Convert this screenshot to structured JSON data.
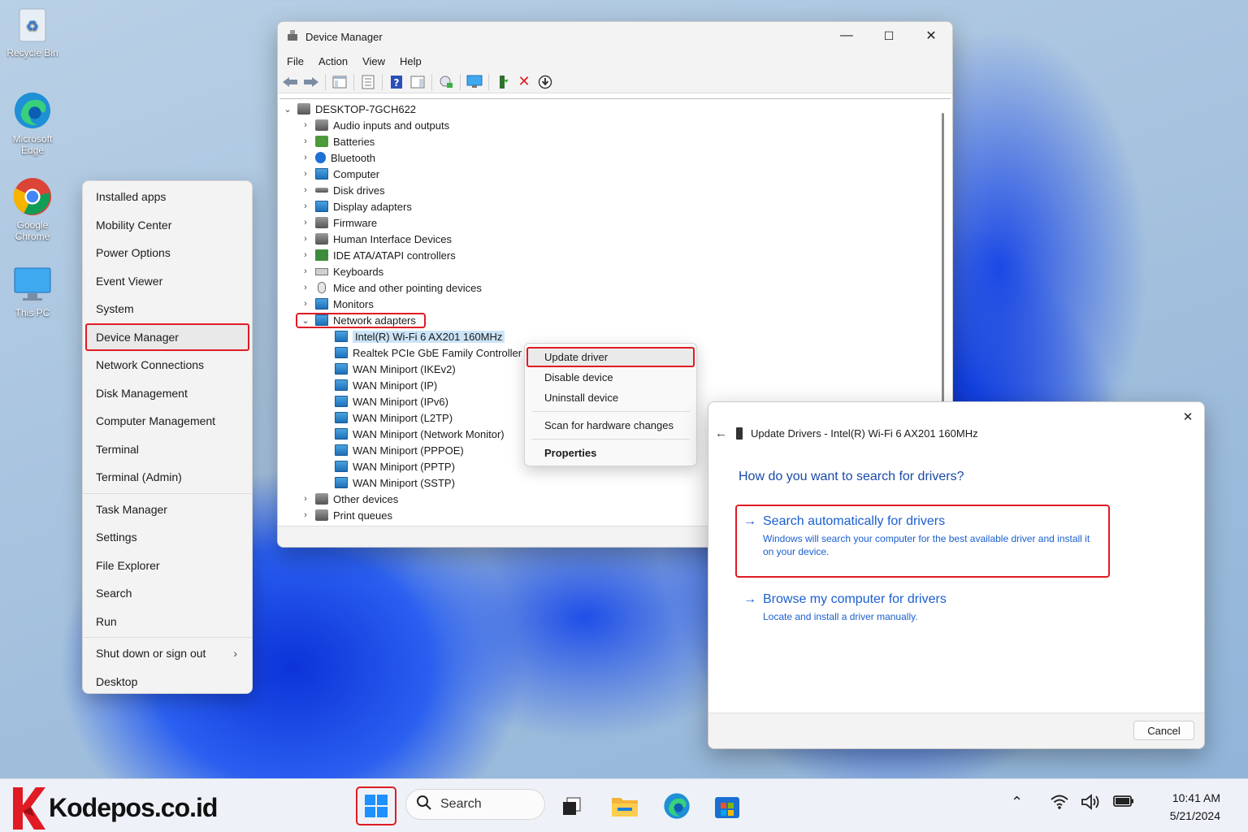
{
  "desktop": {
    "icons": [
      {
        "label": "Recycle Bin",
        "icon": "recycle-bin-icon"
      },
      {
        "label": "Microsoft Edge",
        "icon": "edge-icon"
      },
      {
        "label": "Google Chrome",
        "icon": "chrome-icon"
      },
      {
        "label": "This PC",
        "icon": "this-pc-icon"
      }
    ]
  },
  "winx_menu": {
    "items": [
      "Installed apps",
      "Mobility Center",
      "Power Options",
      "Event Viewer",
      "System",
      "Device Manager",
      "Network Connections",
      "Disk Management",
      "Computer Management",
      "Terminal",
      "Terminal (Admin)",
      "Task Manager",
      "Settings",
      "File Explorer",
      "Search",
      "Run",
      "Shut down or sign out",
      "Desktop"
    ],
    "selected": "Device Manager"
  },
  "device_manager": {
    "title": "Device Manager",
    "menu": [
      "File",
      "Action",
      "View",
      "Help"
    ],
    "window_controls": {
      "minimize": "—",
      "maximize": "☐",
      "close": "✕"
    },
    "tree": {
      "root": "DESKTOP-7GCH622",
      "categories": [
        "Audio inputs and outputs",
        "Batteries",
        "Bluetooth",
        "Computer",
        "Disk drives",
        "Display adapters",
        "Firmware",
        "Human Interface Devices",
        "IDE ATA/ATAPI controllers",
        "Keyboards",
        "Mice and other pointing devices",
        "Monitors"
      ],
      "expanded": "Network adapters",
      "network_adapters": [
        "Intel(R) Wi-Fi 6 AX201 160MHz",
        "Realtek PCIe GbE Family Controller",
        "WAN Miniport (IKEv2)",
        "WAN Miniport (IP)",
        "WAN Miniport (IPv6)",
        "WAN Miniport (L2TP)",
        "WAN Miniport (Network Monitor)",
        "WAN Miniport (PPPOE)",
        "WAN Miniport (PPTP)",
        "WAN Miniport (SSTP)"
      ],
      "after": [
        "Other devices",
        "Print queues"
      ]
    }
  },
  "context_menu": {
    "items": [
      "Update driver",
      "Disable device",
      "Uninstall device"
    ],
    "scan": "Scan for hardware changes",
    "properties": "Properties"
  },
  "update_drivers": {
    "title": "Update Drivers - Intel(R) Wi-Fi 6 AX201 160MHz",
    "question": "How do you want to search for drivers?",
    "option_auto_title": "Search automatically for drivers",
    "option_auto_desc": "Windows will search your computer for the best available driver and install it on your device.",
    "option_browse_title": "Browse my computer for drivers",
    "option_browse_desc": "Locate and install a driver manually.",
    "cancel": "Cancel"
  },
  "taskbar": {
    "brand": "Kodepos.co.id",
    "search_label": "Search",
    "time": "10:41 AM",
    "date": "5/21/2024"
  },
  "colors": {
    "highlight": "#e01b24",
    "link": "#1a5fd1",
    "selection": "#cce4f7"
  }
}
